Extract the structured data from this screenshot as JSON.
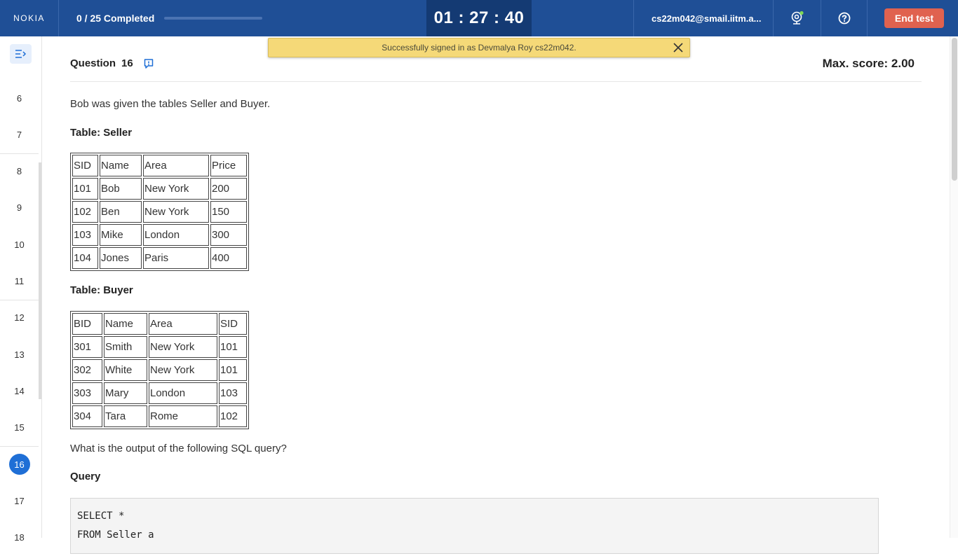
{
  "header": {
    "logo": "NOKIA",
    "progress_text": "0 / 25 Completed",
    "progress_fraction": 0.0,
    "timer": "01 : 27 : 40",
    "user": "cs22m042@smail.iitm.a...",
    "end_label": "End test",
    "cam_status_color": "#7ed957"
  },
  "toast": {
    "message": "Successfully signed in as Devmalya Roy cs22m042."
  },
  "sidebar": {
    "items": [
      "6",
      "7",
      "8",
      "9",
      "10",
      "11",
      "12",
      "13",
      "14",
      "15",
      "16",
      "17",
      "18"
    ],
    "active": "16"
  },
  "question": {
    "label": "Question",
    "number": "16",
    "max_score": "Max. score: 2.00",
    "intro": "Bob was given the tables Seller and Buyer.",
    "seller_heading": "Table: Seller",
    "seller": [
      [
        "SID",
        "Name",
        "Area",
        "Price"
      ],
      [
        "101",
        "Bob",
        "New York",
        "200"
      ],
      [
        "102",
        "Ben",
        "New York",
        "150"
      ],
      [
        "103",
        "Mike",
        "London",
        "300"
      ],
      [
        "104",
        "Jones",
        "Paris",
        "400"
      ]
    ],
    "buyer_heading": "Table: Buyer",
    "buyer": [
      [
        "BID",
        "Name",
        "Area",
        "SID"
      ],
      [
        "301",
        "Smith",
        "New York",
        "101"
      ],
      [
        "302",
        "White",
        "New York",
        "101"
      ],
      [
        "303",
        "Mary",
        "London",
        "103"
      ],
      [
        "304",
        "Tara",
        "Rome",
        "102"
      ]
    ],
    "prompt": "What is the output of the following SQL query?",
    "query_heading": "Query",
    "query_lines": [
      "SELECT *",
      "FROM Seller a"
    ]
  }
}
